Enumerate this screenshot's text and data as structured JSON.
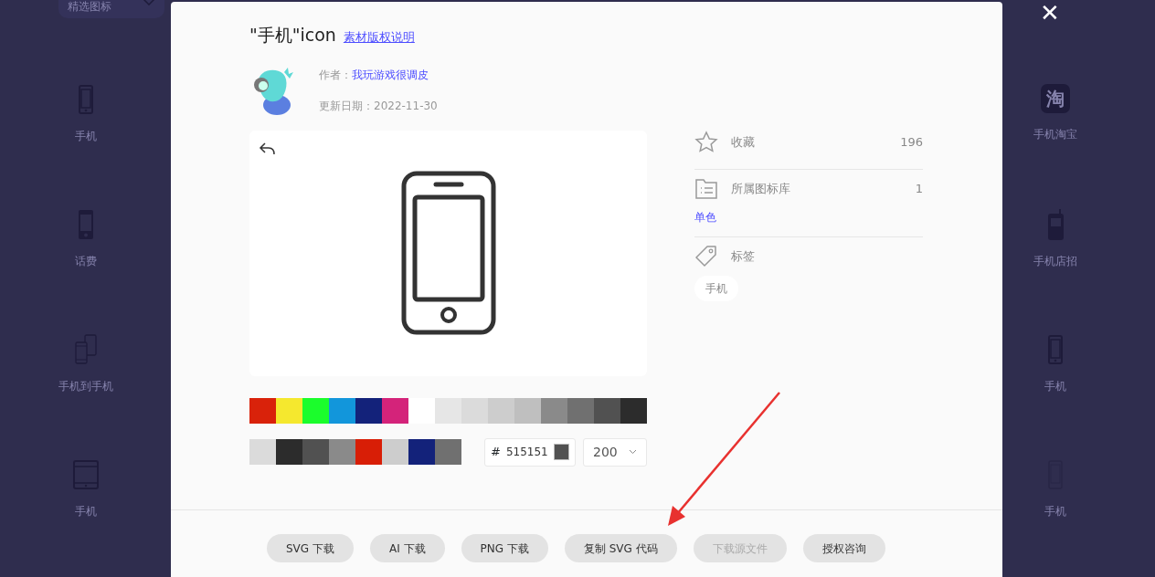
{
  "background": {
    "dropdown": {
      "label": "精选图标"
    },
    "left_items": [
      {
        "kind": "phone-outline",
        "label": "手机"
      },
      {
        "kind": "phone-filled",
        "label": "话费"
      },
      {
        "kind": "two-phones",
        "label": "手机到手机"
      },
      {
        "kind": "tablet",
        "label": "手机"
      }
    ],
    "right_items": [
      {
        "kind": "glyph-tile",
        "glyph": "淘",
        "label": "手机淘宝"
      },
      {
        "kind": "phone-antenna",
        "label": "手机店招"
      },
      {
        "kind": "phone-outline",
        "label": "手机"
      },
      {
        "kind": "phone-faint",
        "label": "手机"
      }
    ]
  },
  "close": {
    "glyph": "✕"
  },
  "dialog": {
    "title": "\"手机\"icon",
    "copyright_link": "素材版权说明",
    "author_label": "作者：",
    "author": "我玩游戏很调皮",
    "date_label": "更新日期：",
    "date": "2022-11-30",
    "info": [
      {
        "kind": "favorite",
        "label": "收藏",
        "count": "196"
      },
      {
        "kind": "library",
        "label": "所属图标库",
        "count": "1",
        "link": "单色"
      },
      {
        "kind": "tags",
        "label": "标签",
        "tags": [
          "手机"
        ]
      }
    ],
    "palette": [
      {
        "color": "#d9220a"
      },
      {
        "color": "#f5e82e"
      },
      {
        "color": "#1bfd2c"
      },
      {
        "color": "#1296db"
      },
      {
        "color": "#13227a"
      },
      {
        "color": "#d4237a"
      },
      {
        "color": "#ffffff"
      },
      {
        "color": "#e6e6e6"
      },
      {
        "color": "#dbdbdb"
      },
      {
        "color": "#cdcdcd"
      },
      {
        "color": "#bfbfbf"
      },
      {
        "color": "#8a8a8a"
      },
      {
        "color": "#707070"
      },
      {
        "color": "#515151"
      },
      {
        "color": "#2c2c2c"
      }
    ],
    "recent_colors": [
      {
        "color": "#dbdbdb"
      },
      {
        "color": "#2c2c2c"
      },
      {
        "color": "#515151"
      },
      {
        "color": "#8a8a8a"
      },
      {
        "color": "#d81e06"
      },
      {
        "color": "#cdcdcd"
      },
      {
        "color": "#13227a"
      },
      {
        "color": "#707070"
      }
    ],
    "hex_prefix": "#",
    "hex_value": "515151",
    "size": "200",
    "buttons": [
      {
        "label": "SVG 下载",
        "disabled": false
      },
      {
        "label": "AI 下载",
        "disabled": false
      },
      {
        "label": "PNG 下载",
        "disabled": false
      },
      {
        "label": "复制 SVG 代码",
        "disabled": false
      },
      {
        "label": "下载源文件",
        "disabled": true
      },
      {
        "label": "授权咨询",
        "disabled": false
      }
    ]
  }
}
